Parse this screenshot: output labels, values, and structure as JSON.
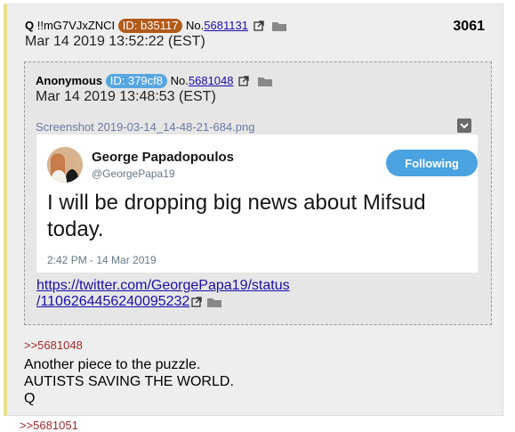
{
  "post": {
    "name": "Q",
    "tripcode": "!!mG7VJxZNCI",
    "id_badge": "ID: b35117",
    "id_color": "#b25a19",
    "no_label": "No.",
    "no_link": "5681131",
    "date": "Mar 14 2019 13:52:22 (EST)",
    "post_number": "3061"
  },
  "quoted": {
    "name": "Anonymous",
    "id_badge": "ID: 379cf8",
    "id_color": "#57a6e0",
    "no_label": "No.",
    "no_link": "5681048",
    "date": "Mar 14 2019 13:48:53 (EST)",
    "filename": "Screenshot 2019-03-14_14-48-21-684.png",
    "tweet": {
      "display_name": "George Papadopoulos",
      "handle": "@GeorgePapa19",
      "follow_label": "Following",
      "text": "I will be dropping big news about Mifsud today.",
      "timestamp": "2:42 PM - 14 Mar 2019"
    },
    "link_line1": "https://twitter.com/GeorgePapa19/status",
    "link_line2": "/1106264456240095232"
  },
  "reply": {
    "ref": ">>5681048",
    "lines": [
      "Another piece to the puzzle.",
      "AUTISTS SAVING THE WORLD.",
      "Q"
    ]
  },
  "next_ref": ">>5681051",
  "icons": [
    "external-link-icon",
    "folder-icon",
    "download-icon",
    "avatar"
  ]
}
